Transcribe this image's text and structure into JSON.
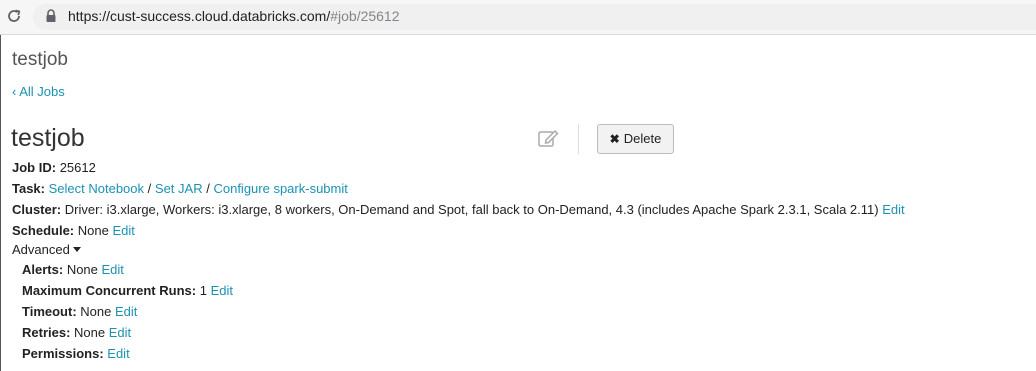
{
  "browser": {
    "url_main": "https://cust-success.cloud.databricks.com/",
    "url_hash": "#job/25612"
  },
  "page": {
    "app_title": "testjob",
    "back_link": "‹ All Jobs",
    "job_name": "testjob",
    "delete_label": "Delete"
  },
  "details": {
    "job_id_label": "Job ID:",
    "job_id_value": "25612",
    "task_label": "Task:",
    "task_select_notebook": "Select Notebook",
    "sep": "/",
    "task_set_jar": "Set JAR",
    "task_configure": "Configure spark-submit",
    "cluster_label": "Cluster:",
    "cluster_value": "Driver: i3.xlarge, Workers: i3.xlarge, 8 workers, On-Demand and Spot, fall back to On-Demand, 4.3 (includes Apache Spark 2.3.1, Scala 2.11)",
    "schedule_label": "Schedule:",
    "schedule_value": "None",
    "edit": "Edit",
    "advanced_label": "Advanced"
  },
  "advanced": {
    "alerts_label": "Alerts:",
    "alerts_value": "None",
    "max_runs_label": "Maximum Concurrent Runs:",
    "max_runs_value": "1",
    "timeout_label": "Timeout:",
    "timeout_value": "None",
    "retries_label": "Retries:",
    "retries_value": "None",
    "permissions_label": "Permissions:"
  },
  "colors": {
    "link": "#1b92b3",
    "text": "#222222"
  },
  "icons": [
    "reload-icon",
    "lock-icon",
    "edit-pencil-icon",
    "close-x-icon",
    "caret-down-icon"
  ]
}
